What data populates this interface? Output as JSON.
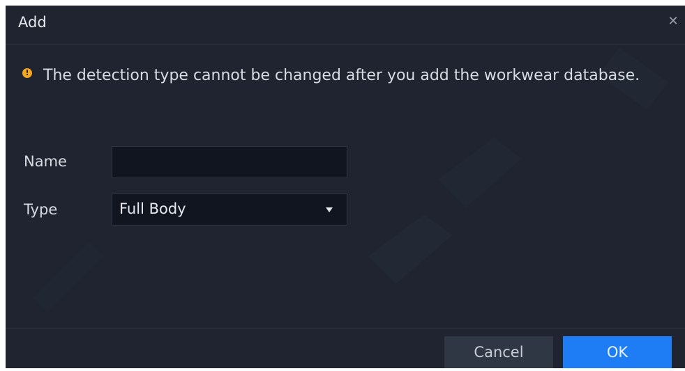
{
  "dialog": {
    "title": "Add",
    "close_icon": "close-icon"
  },
  "notice": {
    "icon": "warning-icon",
    "icon_color": "#f5a623",
    "text": "The detection type cannot be changed after you add the workwear database."
  },
  "form": {
    "name_label": "Name",
    "name_value": "",
    "type_label": "Type",
    "type_value": "Full Body"
  },
  "footer": {
    "cancel_label": "Cancel",
    "ok_label": "OK"
  },
  "colors": {
    "background": "#1f2430",
    "accent": "#1e7cf5",
    "warning": "#f5a623"
  }
}
